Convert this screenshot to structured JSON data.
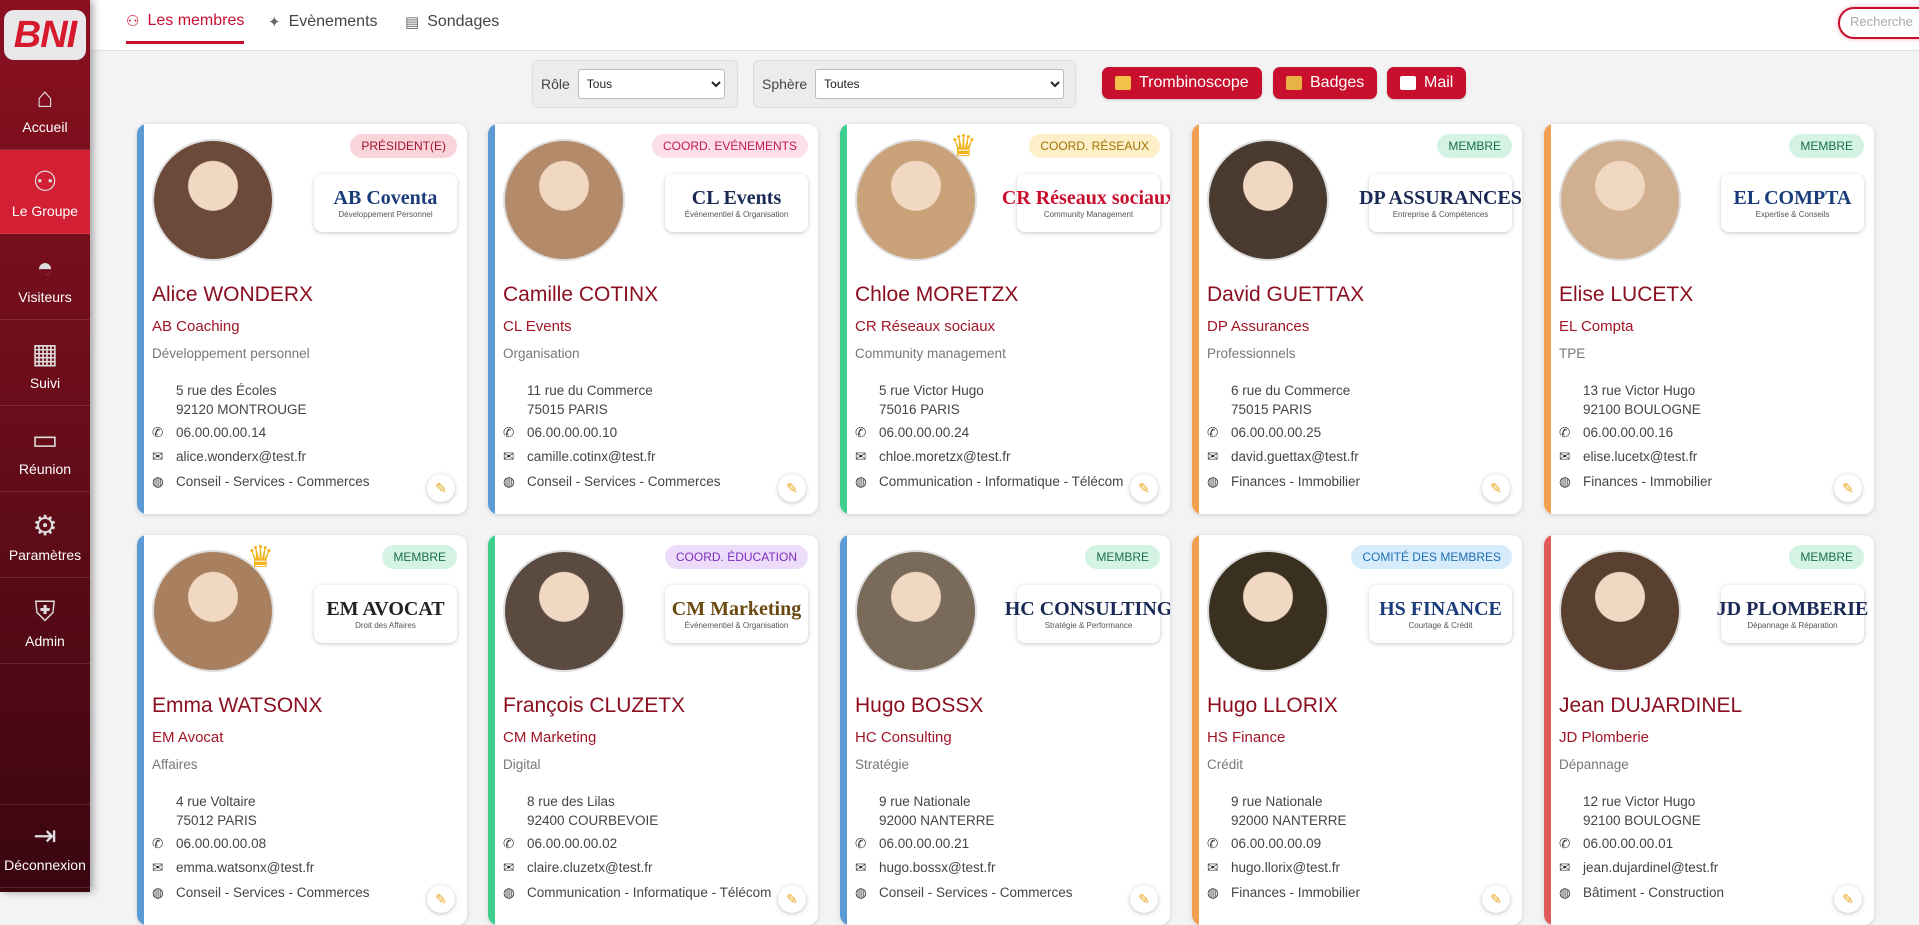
{
  "sidebar": {
    "logo": "BNI",
    "items": [
      {
        "label": "Accueil",
        "icon": "house-icon",
        "glyph": "⌂"
      },
      {
        "label": "Le Groupe",
        "icon": "group-icon",
        "glyph": "⚇"
      },
      {
        "label": "Visiteurs",
        "icon": "visitor-hat-icon",
        "glyph": "◓"
      },
      {
        "label": "Suivi",
        "icon": "chart-icon",
        "glyph": "▦"
      },
      {
        "label": "Réunion",
        "icon": "presentation-board-icon",
        "glyph": "▭"
      },
      {
        "label": "Paramètres",
        "icon": "gear-icon",
        "glyph": "⚙"
      },
      {
        "label": "Admin",
        "icon": "shield-icon",
        "glyph": "⛨"
      },
      {
        "label": "Déconnexion",
        "icon": "logout-door-icon",
        "glyph": "⇥"
      }
    ]
  },
  "tabs": [
    {
      "label": "Les membres",
      "icon": "members-icon",
      "glyph": "⚇"
    },
    {
      "label": "Evènements",
      "icon": "party-popper-icon",
      "glyph": "✦"
    },
    {
      "label": "Sondages",
      "icon": "clipboard-icon",
      "glyph": "▤"
    }
  ],
  "search": {
    "placeholder": "Recherche",
    "value": ""
  },
  "filters": {
    "role": {
      "label": "Rôle",
      "value": "Tous"
    },
    "sphere": {
      "label": "Sphère",
      "value": "Toutes"
    }
  },
  "actions": {
    "trombinoscope": "Trombinoscope",
    "badges": "Badges",
    "mail": "Mail"
  },
  "colors": {
    "brand": "#c8102e",
    "sidebar": "#7a0e1c"
  },
  "members": [
    {
      "name": "Alice WONDERX",
      "company": "AB Coaching",
      "activity": "Développement personnel",
      "address1": "5 rue des Écoles",
      "address2": "92120 MONTROUGE",
      "phone": "06.00.00.00.14",
      "email": "alice.wonderx@test.fr",
      "sphere": "Conseil - Services - Commerces",
      "role": "PRÉSIDENT(E)",
      "logo_text": "AB Coventa",
      "logo_sub": "Développement Personnel",
      "stripe": "#5b9bd5",
      "badge_bg": "#f9d5db",
      "badge_fg": "#a3122a",
      "logo_color": "#1a3c7a",
      "crown": false,
      "photo": "#6b4a3a"
    },
    {
      "name": "Camille COTINX",
      "company": "CL Events",
      "activity": "Organisation",
      "address1": "11 rue du Commerce",
      "address2": "75015 PARIS",
      "phone": "06.00.00.00.10",
      "email": "camille.cotinx@test.fr",
      "sphere": "Conseil - Services - Commerces",
      "role": "COORD. EVÉNEMENTS",
      "logo_text": "CL Events",
      "logo_sub": "Événementiel & Organisation",
      "stripe": "#5b9bd5",
      "badge_bg": "#fcdfe7",
      "badge_fg": "#c2185b",
      "logo_color": "#1a2a55",
      "crown": false,
      "photo": "#b38a6a"
    },
    {
      "name": "Chloe MORETZX",
      "company": "CR Réseaux sociaux",
      "activity": "Community management",
      "address1": "5 rue Victor Hugo",
      "address2": "75016 PARIS",
      "phone": "06.00.00.00.24",
      "email": "chloe.moretzx@test.fr",
      "sphere": "Communication - Informatique - Télécom",
      "role": "COORD. RÉSEAUX",
      "logo_text": "CR Réseaux sociaux",
      "logo_sub": "Community Management",
      "stripe": "#3ecf8e",
      "badge_bg": "#fdf0c8",
      "badge_fg": "#a07000",
      "logo_color": "#c8102e",
      "crown": true,
      "photo": "#c9a27a"
    },
    {
      "name": "David GUETTAX",
      "company": "DP Assurances",
      "activity": "Professionnels",
      "address1": "6 rue du Commerce",
      "address2": "75015 PARIS",
      "phone": "06.00.00.00.25",
      "email": "david.guettax@test.fr",
      "sphere": "Finances - Immobilier",
      "role": "MEMBRE",
      "logo_text": "DP ASSURANCES",
      "logo_sub": "Entreprise & Compétences",
      "stripe": "#f0a050",
      "badge_bg": "#d4f3e4",
      "badge_fg": "#17704a",
      "logo_color": "#1a2a55",
      "crown": false,
      "photo": "#4a3a30"
    },
    {
      "name": "Elise LUCETX",
      "company": "EL Compta",
      "activity": "TPE",
      "address1": "13 rue Victor Hugo",
      "address2": "92100 BOULOGNE",
      "phone": "06.00.00.00.16",
      "email": "elise.lucetx@test.fr",
      "sphere": "Finances - Immobilier",
      "role": "MEMBRE",
      "logo_text": "EL COMPTA",
      "logo_sub": "Expertise & Conseils",
      "stripe": "#f0a050",
      "badge_bg": "#d4f3e4",
      "badge_fg": "#17704a",
      "logo_color": "#1a3c7a",
      "crown": false,
      "photo": "#d0b090"
    },
    {
      "name": "Emma WATSONX",
      "company": "EM Avocat",
      "activity": "Affaires",
      "address1": "4 rue Voltaire",
      "address2": "75012 PARIS",
      "phone": "06.00.00.00.08",
      "email": "emma.watsonx@test.fr",
      "sphere": "Conseil - Services - Commerces",
      "role": "MEMBRE",
      "logo_text": "EM AVOCAT",
      "logo_sub": "Droit des Affaires",
      "stripe": "#5b9bd5",
      "badge_bg": "#d4f3e4",
      "badge_fg": "#17704a",
      "logo_color": "#222222",
      "crown": true,
      "photo": "#a88060"
    },
    {
      "name": "François CLUZETX",
      "company": "CM Marketing",
      "activity": "Digital",
      "address1": "8 rue des Lilas",
      "address2": "92400 COURBEVOIE",
      "phone": "06.00.00.00.02",
      "email": "claire.cluzetx@test.fr",
      "sphere": "Communication - Informatique - Télécom",
      "role": "COORD. ÉDUCATION",
      "logo_text": "CM Marketing",
      "logo_sub": "Événementiel & Organisation",
      "stripe": "#3ecf8e",
      "badge_bg": "#ecdcfa",
      "badge_fg": "#7b2cbf",
      "logo_color": "#6a4a10",
      "crown": false,
      "photo": "#5a4a40"
    },
    {
      "name": "Hugo BOSSX",
      "company": "HC Consulting",
      "activity": "Stratégie",
      "address1": "9 rue Nationale",
      "address2": "92000 NANTERRE",
      "phone": "06.00.00.00.21",
      "email": "hugo.bossx@test.fr",
      "sphere": "Conseil - Services - Commerces",
      "role": "MEMBRE",
      "logo_text": "HC CONSULTING",
      "logo_sub": "Stratégie & Performance",
      "stripe": "#5b9bd5",
      "badge_bg": "#d4f3e4",
      "badge_fg": "#17704a",
      "logo_color": "#1a2a55",
      "crown": false,
      "photo": "#7a6a5a"
    },
    {
      "name": "Hugo LLORIX",
      "company": "HS Finance",
      "activity": "Crédit",
      "address1": "9 rue Nationale",
      "address2": "92000 NANTERRE",
      "phone": "06.00.00.00.09",
      "email": "hugo.llorix@test.fr",
      "sphere": "Finances - Immobilier",
      "role": "COMITÉ DES MEMBRES",
      "logo_text": "HS FINANCE",
      "logo_sub": "Courtage & Crédit",
      "stripe": "#f0a050",
      "badge_bg": "#d6ecfb",
      "badge_fg": "#1f6fb2",
      "logo_color": "#1a3c7a",
      "crown": false,
      "photo": "#3a3020"
    },
    {
      "name": "Jean DUJARDINEL",
      "company": "JD Plomberie",
      "activity": "Dépannage",
      "address1": "12 rue Victor Hugo",
      "address2": "92100 BOULOGNE",
      "phone": "06.00.00.00.01",
      "email": "jean.dujardinel@test.fr",
      "sphere": "Bâtiment - Construction",
      "role": "MEMBRE",
      "logo_text": "JD PLOMBERIE",
      "logo_sub": "Dépannage & Réparation",
      "stripe": "#e05a5a",
      "badge_bg": "#d4f3e4",
      "badge_fg": "#17704a",
      "logo_color": "#1a2a55",
      "crown": false,
      "photo": "#5a4030"
    }
  ]
}
